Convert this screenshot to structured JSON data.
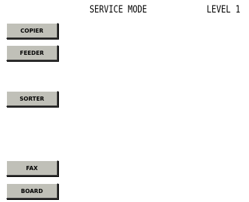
{
  "header": {
    "title": "SERVICE MODE",
    "level": "LEVEL 1"
  },
  "buttons": {
    "copier": "COPIER",
    "feeder": "FEEDER",
    "sorter": "SORTER",
    "fax": "FAX",
    "board": "BOARD"
  },
  "colors": {
    "button_face": "#c0c0b8",
    "background": "#ffffff"
  }
}
